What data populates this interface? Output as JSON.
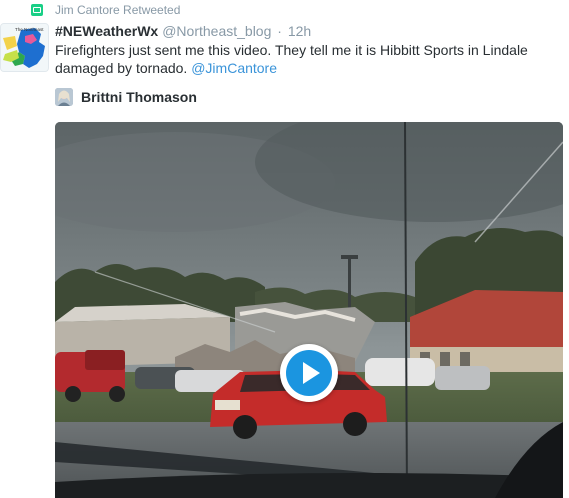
{
  "retweet": {
    "label": "Jim Cantore Retweeted",
    "icon": "retweet-icon"
  },
  "tweet": {
    "display_name": "#NEWeatherWx",
    "handle": "@Northeast_blog",
    "separator": "·",
    "time": "12h",
    "text": "Firefighters just sent me this video.  They tell me it is Hibbitt Sports in Lindale damaged by tornado. ",
    "mention": "@JimCantore",
    "tagged_user": "Brittni Thomason"
  },
  "avatar_map": {
    "title": "The Northeast"
  },
  "colors": {
    "link": "#3b94d9",
    "retweet_green": "#19cf86",
    "muted": "#8899a6",
    "play": "#1b95e0"
  }
}
